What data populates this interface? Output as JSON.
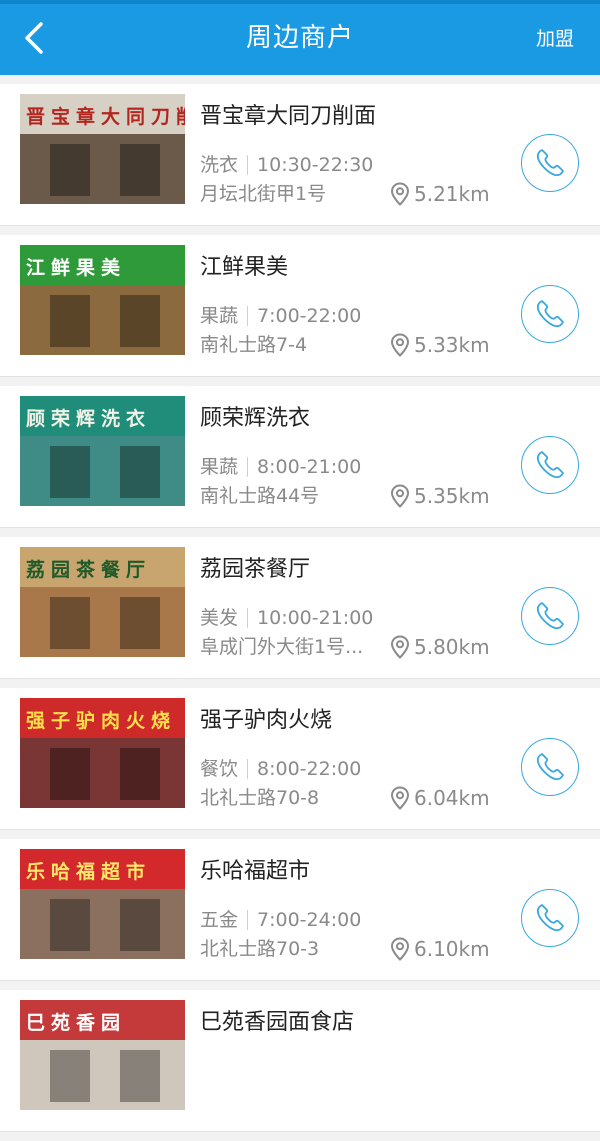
{
  "header": {
    "title": "周边商户",
    "join_label": "加盟"
  },
  "merchants": [
    {
      "name": "晋宝章大同刀削面",
      "category": "洗衣",
      "hours": "10:30-22:30",
      "address": "月坛北街甲1号",
      "distance": "5.21km",
      "sign_text": "晋宝章大同刀削面",
      "sign_bg": "#d7d0c5",
      "sign_color": "#b3261e",
      "front_color": "#6b5a4a"
    },
    {
      "name": "江鲜果美",
      "category": "果蔬",
      "hours": "7:00-22:00",
      "address": "南礼士路7-4",
      "distance": "5.33km",
      "sign_text": "江鲜果美",
      "sign_bg": "#2f9a3a",
      "sign_color": "#ffffff",
      "front_color": "#8a6a3e"
    },
    {
      "name": "顾荣辉洗衣",
      "category": "果蔬",
      "hours": "8:00-21:00",
      "address": "南礼士路44号",
      "distance": "5.35km",
      "sign_text": "顾荣辉洗衣",
      "sign_bg": "#1f8d7a",
      "sign_color": "#f2f2e6",
      "front_color": "#3f8c86"
    },
    {
      "name": "荔园茶餐厅",
      "category": "美发",
      "hours": "10:00-21:00",
      "address": "阜成门外大街1号...",
      "distance": "5.80km",
      "sign_text": "荔园茶餐厅",
      "sign_bg": "#c8a56f",
      "sign_color": "#1f5a2a",
      "front_color": "#a9784a"
    },
    {
      "name": "强子驴肉火烧",
      "category": "餐饮",
      "hours": "8:00-22:00",
      "address": "北礼士路70-8",
      "distance": "6.04km",
      "sign_text": "强子驴肉火烧",
      "sign_bg": "#cf2a2a",
      "sign_color": "#ffe04a",
      "front_color": "#7a3535"
    },
    {
      "name": "乐哈福超市",
      "category": "五金",
      "hours": "7:00-24:00",
      "address": "北礼士路70-3",
      "distance": "6.10km",
      "sign_text": "乐哈福超市",
      "sign_bg": "#d3282c",
      "sign_color": "#ffe86a",
      "front_color": "#8b7060"
    },
    {
      "name": "巳苑香园面食店",
      "category": "",
      "hours": "",
      "address": "",
      "distance": "",
      "sign_text": "巳苑香园",
      "sign_bg": "#c43a3a",
      "sign_color": "#ffffff",
      "front_color": "#cfc6bc"
    }
  ],
  "colors": {
    "header_bg": "#1a9ae3",
    "accent": "#3aa8e0",
    "text_primary": "#222222",
    "text_secondary": "#8a8a8a"
  },
  "icons": {
    "back": "chevron-left-icon",
    "location": "map-pin-icon",
    "call": "phone-icon"
  }
}
